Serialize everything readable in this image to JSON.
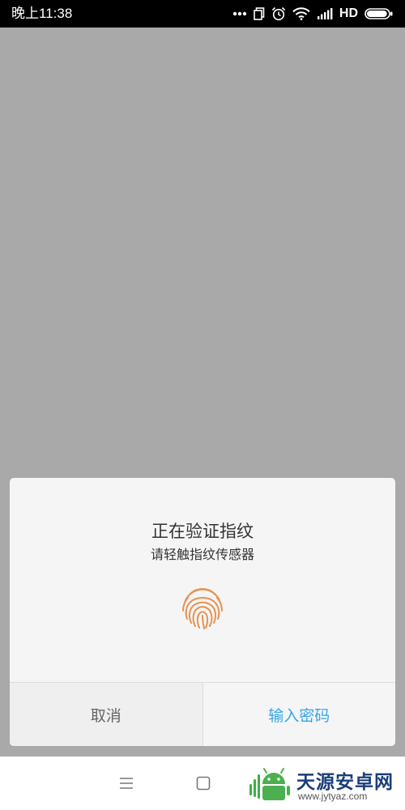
{
  "status_bar": {
    "time": "晚上11:38",
    "icons": [
      "more-dots-icon",
      "copy-icon",
      "alarm-clock-icon",
      "wifi-icon",
      "signal-icon"
    ],
    "network_label": "HD",
    "battery_level": 0.95
  },
  "dialog": {
    "title": "正在验证指纹",
    "subtitle": "请轻触指纹传感器",
    "icon": "fingerprint-icon",
    "icon_color": "#e8914e",
    "cancel_label": "取消",
    "password_label": "输入密码",
    "accent_color": "#33a6e8"
  },
  "nav_bar": {
    "icons": [
      "menu-icon",
      "home-square-icon"
    ]
  },
  "watermark": {
    "text": "天源安卓网",
    "url": "www.jytyaz.com"
  }
}
